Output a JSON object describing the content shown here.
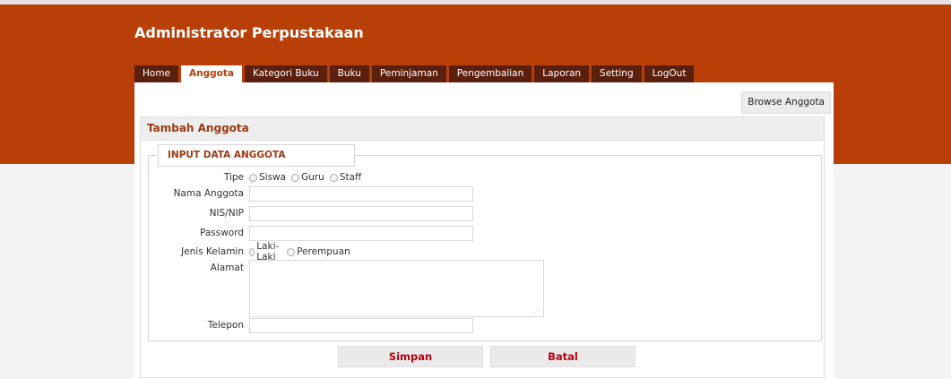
{
  "app": {
    "title": "Administrator Perpustakaan"
  },
  "nav": {
    "tabs": [
      {
        "label": "Home"
      },
      {
        "label": "Anggota"
      },
      {
        "label": "Kategori Buku"
      },
      {
        "label": "Buku"
      },
      {
        "label": "Peminjaman"
      },
      {
        "label": "Pengembalian"
      },
      {
        "label": "Laporan"
      },
      {
        "label": "Setting"
      },
      {
        "label": "LogOut"
      }
    ],
    "active": "Anggota"
  },
  "toolbar": {
    "browse_label": "Browse Anggota"
  },
  "panel": {
    "title": "Tambah Anggota",
    "legend": "INPUT DATA ANGGOTA"
  },
  "form": {
    "tipe": {
      "label": "Tipe",
      "options": [
        "Siswa",
        "Guru",
        "Staff"
      ]
    },
    "nama": {
      "label": "Nama Anggota",
      "value": ""
    },
    "nis": {
      "label": "NIS/NIP",
      "value": ""
    },
    "password": {
      "label": "Password",
      "value": ""
    },
    "jenis_kelamin": {
      "label": "Jenis Kelamin",
      "options": [
        "Laki-Laki",
        "Perempuan"
      ]
    },
    "alamat": {
      "label": "Alamat",
      "value": ""
    },
    "telepon": {
      "label": "Telepon",
      "value": ""
    }
  },
  "buttons": {
    "save_label": "Simpan",
    "cancel_label": "Batal"
  },
  "colors": {
    "brand": "#b83f08",
    "tab_dark": "#5b1f0d",
    "heading": "#9b3a12",
    "button_text": "#b8000f"
  }
}
